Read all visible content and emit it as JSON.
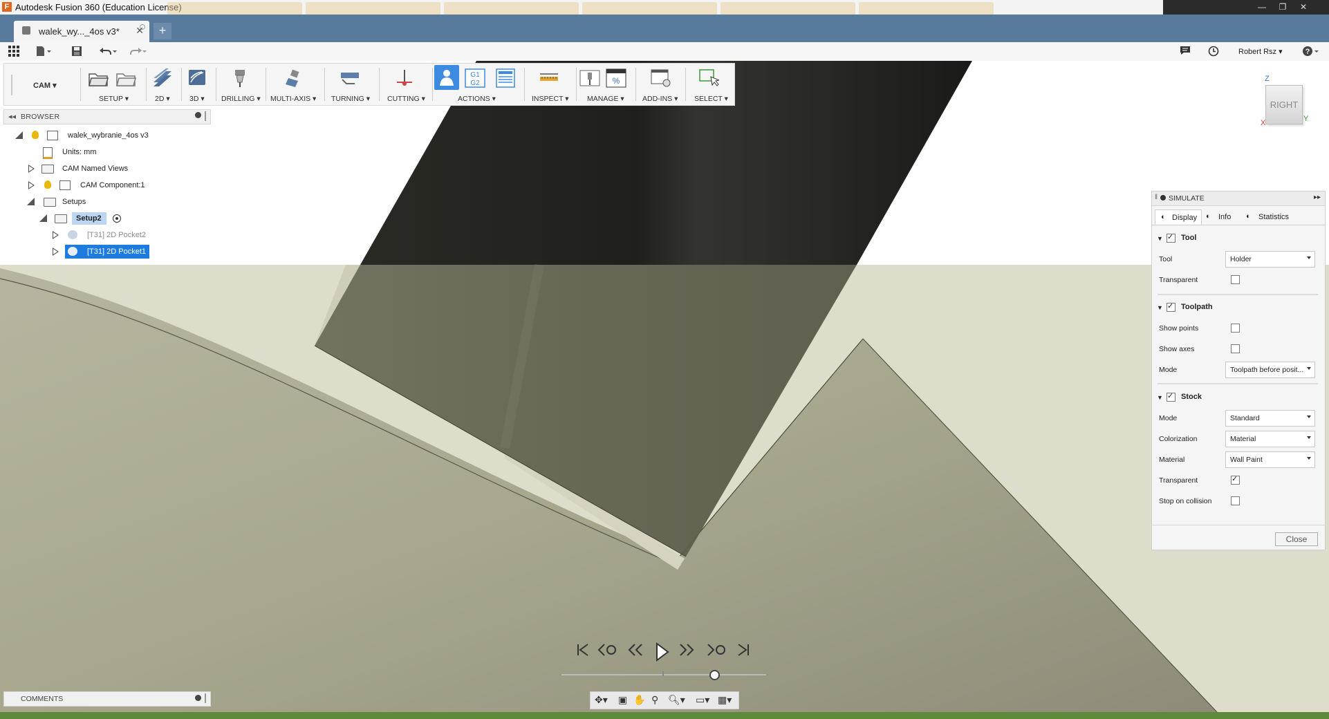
{
  "window": {
    "title": "Autodesk Fusion 360 (Education License)"
  },
  "document_tab": {
    "label": "walek_wy..._4os v3*"
  },
  "user": {
    "name": "Robert Rsz ▾"
  },
  "workspace": {
    "label": "CAM ▾"
  },
  "toolbar": {
    "setup": "SETUP ▾",
    "twod": "2D ▾",
    "threed": "3D ▾",
    "drilling": "DRILLING ▾",
    "multiaxis": "MULTI-AXIS ▾",
    "turning": "TURNING ▾",
    "cutting": "CUTTING ▾",
    "actions": "ACTIONS ▾",
    "inspect": "INSPECT ▾",
    "manage": "MANAGE ▾",
    "addins": "ADD-INS ▾",
    "select": "SELECT ▾"
  },
  "browser": {
    "title": "BROWSER",
    "root": "walek_wybranie_4os v3",
    "units": "Units: mm",
    "named_views": "CAM Named Views",
    "component": "CAM Component:1",
    "setups": "Setups",
    "setup2": "Setup2",
    "op1": "[T31] 2D Pocket2",
    "op2": "[T31] 2D Pocket1"
  },
  "viewcube": {
    "face": "RIGHT",
    "z": "Z",
    "x": "X",
    "y": "Y"
  },
  "simulate": {
    "title": "SIMULATE",
    "tabs": {
      "display": "Display",
      "info": "Info",
      "statistics": "Statistics"
    },
    "tool_section": "Tool",
    "tool_label": "Tool",
    "tool_value": "Holder",
    "tool_transparent": "Transparent",
    "toolpath_section": "Toolpath",
    "show_points": "Show points",
    "show_axes": "Show axes",
    "tp_mode_label": "Mode",
    "tp_mode_value": "Toolpath before posit...",
    "stock_section": "Stock",
    "stock_mode_label": "Mode",
    "stock_mode_value": "Standard",
    "colorization_label": "Colorization",
    "colorization_value": "Material",
    "material_label": "Material",
    "material_value": "Wall Paint",
    "stock_transparent": "Transparent",
    "stop_collision": "Stop on collision",
    "close": "Close"
  },
  "comments": {
    "title": "COMMENTS"
  }
}
